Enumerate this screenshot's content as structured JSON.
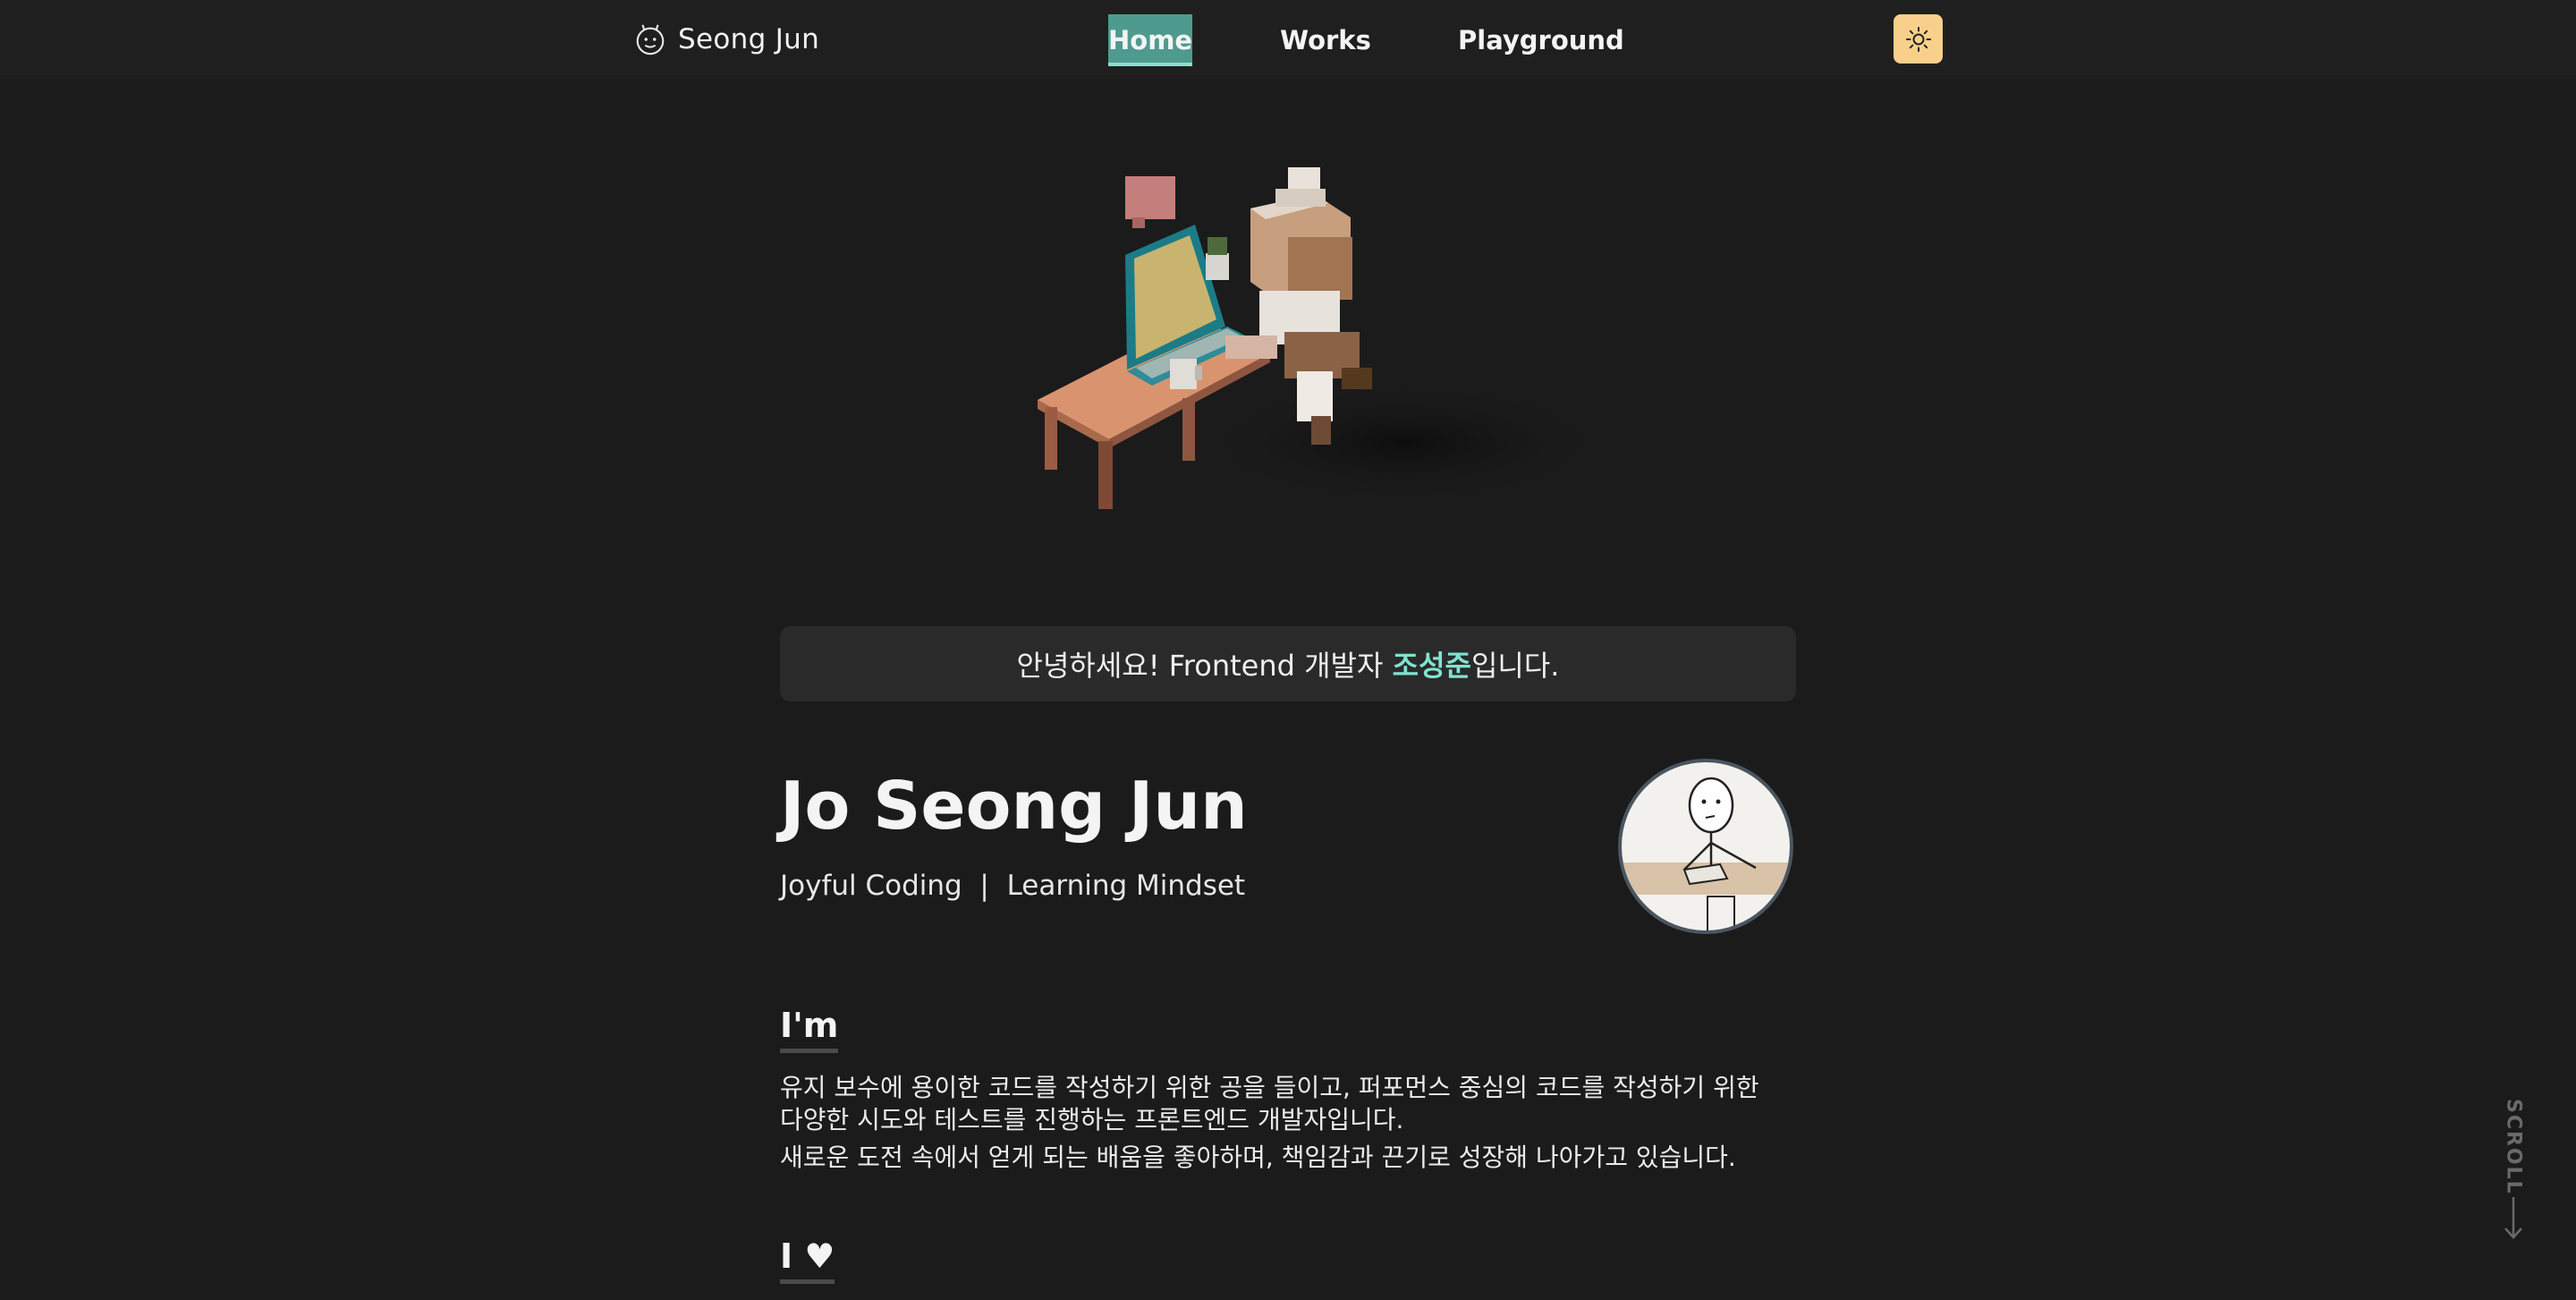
{
  "nav": {
    "brand": "Seong Jun",
    "links": [
      "Home",
      "Works",
      "Playground"
    ],
    "active": "Home",
    "theme_icon": "sun-icon"
  },
  "greeting": {
    "before": "안녕하세요! Frontend 개발자 ",
    "highlight": "조성준",
    "after": "입니다."
  },
  "profile": {
    "name": "Jo Seong Jun",
    "tagline": "Joyful Coding  |  Learning Mindset"
  },
  "sections": {
    "im_title": "I'm",
    "bio_line1": "유지 보수에 용이한 코드를 작성하기 위한 공을 들이고, 퍼포먼스 중심의 코드를 작성하기 위한",
    "bio_line2": "다양한 시도와 테스트를 진행하는 프론트엔드 개발자입니다.",
    "bio_line3": "새로운 도전 속에서 얻게 되는 배움을 좋아하며, 책임감과 끈기로 성장해 나아가고 있습니다.",
    "love_title": "I ♥"
  },
  "scroll_label": "SCROLL",
  "colors": {
    "background": "#1b1b1b",
    "accent": "#7fe3cf",
    "active_tab": "#4f9a8e",
    "theme_button": "#f9d08b"
  }
}
